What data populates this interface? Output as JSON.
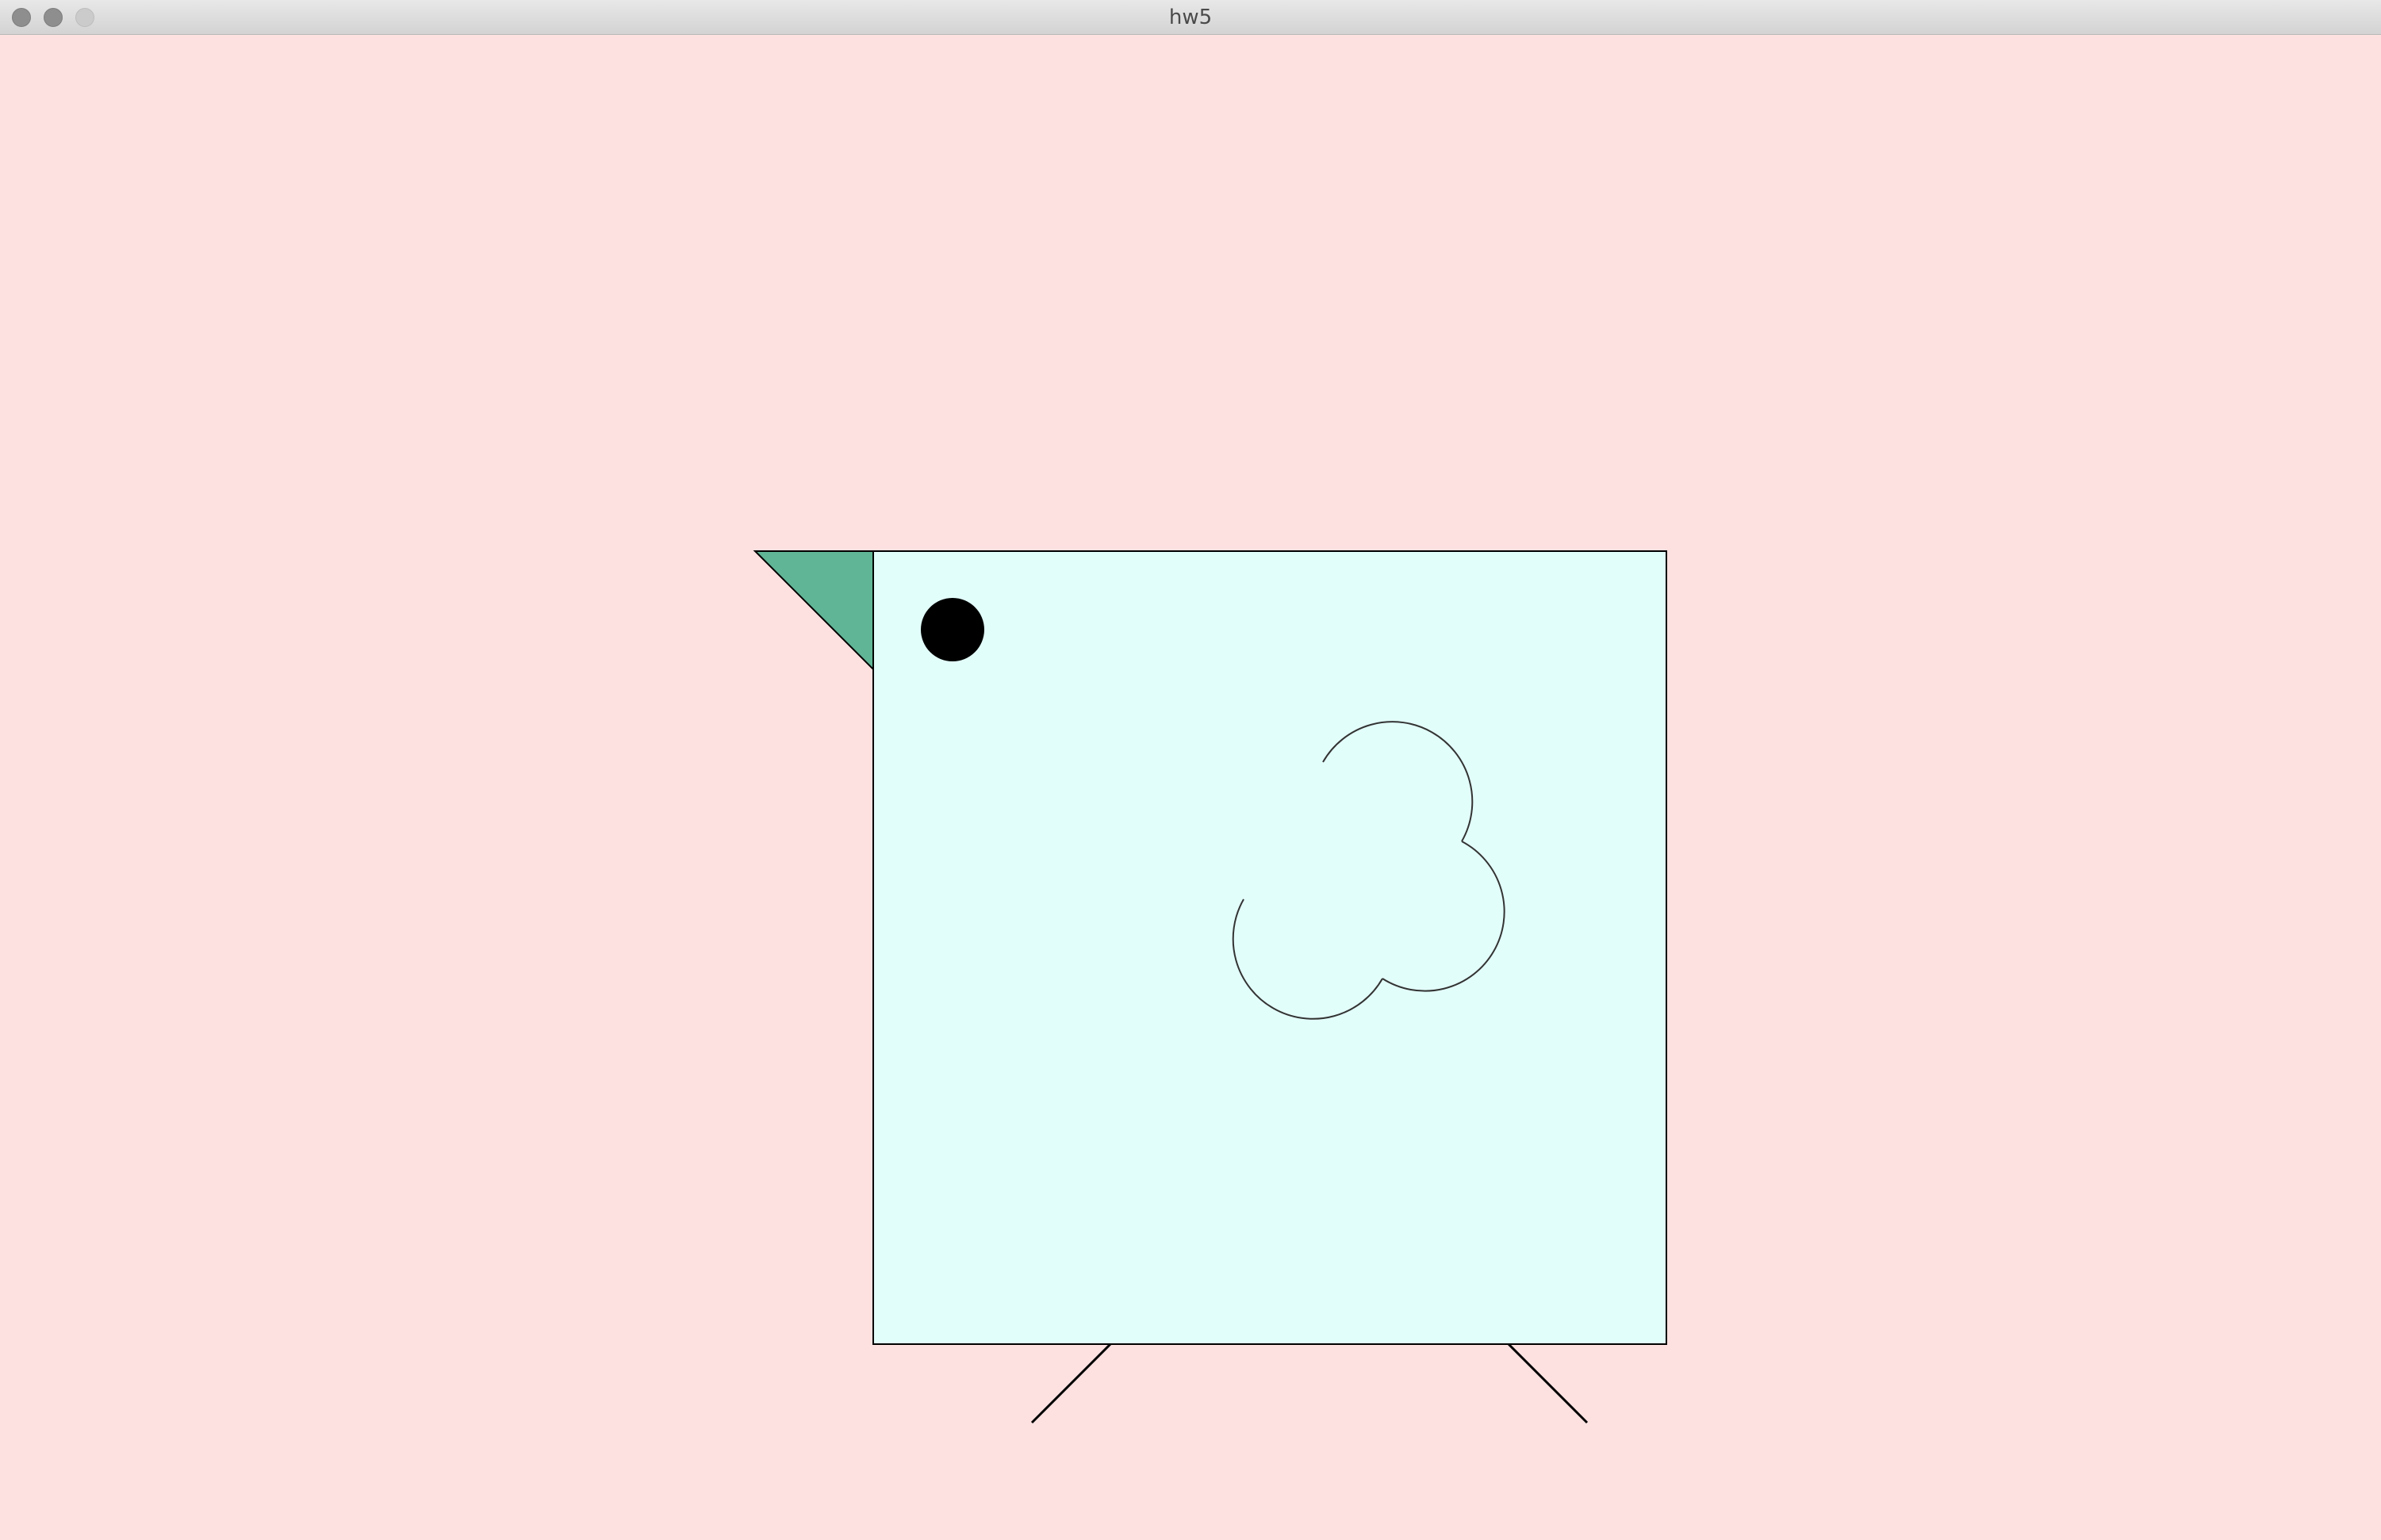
{
  "window": {
    "title": "hw5",
    "controls": {
      "close_icon": "close-icon",
      "minimize_icon": "minimize-icon",
      "zoom_icon": "zoom-icon"
    }
  },
  "canvas": {
    "background_color": "#fde1e1",
    "bird": {
      "body_color": "#e2fefa",
      "beak_color": "#5fb595",
      "eye_color": "#000000",
      "outline_color": "#000000"
    }
  }
}
